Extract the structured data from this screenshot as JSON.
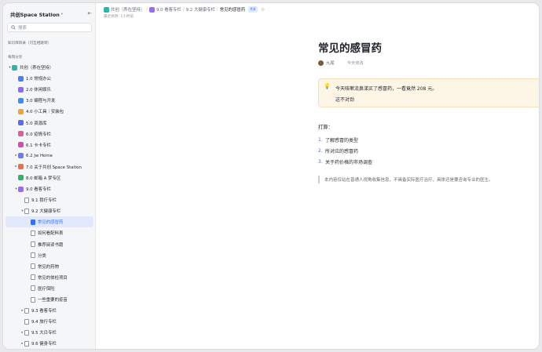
{
  "sidebar": {
    "title": "共创Space Station",
    "search_placeholder": "搜索",
    "section_recent": "知识库目录（可互相跳转）",
    "section_share": "每周分享",
    "tree": [
      {
        "level": 0,
        "arrow": "▾",
        "icon": "node",
        "color": "#2bb5a6",
        "label": "共创（养在坚持）"
      },
      {
        "level": 1,
        "arrow": "",
        "icon": "node",
        "color": "#4a7cff",
        "label": "1.0 常规办公"
      },
      {
        "level": 1,
        "arrow": "",
        "icon": "node",
        "color": "#8b6bf5",
        "label": "2.0 休闲娱乐"
      },
      {
        "level": 1,
        "arrow": "",
        "icon": "node",
        "color": "#3a8cff",
        "label": "3.0 编程与开发"
      },
      {
        "level": 1,
        "arrow": "",
        "icon": "node",
        "color": "#f0a23a",
        "label": "4.0 小工具｜安装包"
      },
      {
        "level": 1,
        "arrow": "",
        "icon": "node",
        "color": "#5b6cf0",
        "label": "5.0 资源库"
      },
      {
        "level": 1,
        "arrow": "",
        "icon": "node",
        "color": "#e05aa0",
        "label": "6.0 疫情专栏"
      },
      {
        "level": 1,
        "arrow": "",
        "icon": "node",
        "color": "#d848b8",
        "label": "6.1 卡卡专栏"
      },
      {
        "level": 1,
        "arrow": "▸",
        "icon": "node",
        "color": "#6a7cf2",
        "label": "6.2 Jw Home"
      },
      {
        "level": 1,
        "arrow": "▸",
        "icon": "node",
        "color": "#f26c4f",
        "label": "7.0 关于共创 Space Station"
      },
      {
        "level": 1,
        "arrow": "",
        "icon": "node",
        "color": "#2bb56a",
        "label": "8.0 邮箱 A 梦专区"
      },
      {
        "level": 1,
        "arrow": "▾",
        "icon": "node",
        "color": "#9c6bf5",
        "label": "9.0 看客专栏"
      },
      {
        "level": 2,
        "arrow": "",
        "icon": "doc",
        "color": "",
        "label": "9.1 猜疗专栏"
      },
      {
        "level": 2,
        "arrow": "▾",
        "icon": "doc",
        "color": "",
        "label": "9.2 大健康专栏"
      },
      {
        "level": 3,
        "arrow": "",
        "icon": "doc",
        "color": "",
        "label": "常见的感冒药",
        "active": true
      },
      {
        "level": 3,
        "arrow": "",
        "icon": "doc",
        "color": "",
        "label": "如何看配料表"
      },
      {
        "level": 3,
        "arrow": "",
        "icon": "doc",
        "color": "",
        "label": "推荐阅读书籍"
      },
      {
        "level": 3,
        "arrow": "",
        "icon": "doc",
        "color": "",
        "label": "分类"
      },
      {
        "level": 3,
        "arrow": "",
        "icon": "doc",
        "color": "",
        "label": "常见的药物"
      },
      {
        "level": 3,
        "arrow": "",
        "icon": "doc",
        "color": "",
        "label": "常见的体检项目"
      },
      {
        "level": 3,
        "arrow": "",
        "icon": "doc",
        "color": "",
        "label": "医疗保险"
      },
      {
        "level": 3,
        "arrow": "",
        "icon": "doc",
        "color": "",
        "label": "一些重要的疫苗"
      },
      {
        "level": 2,
        "arrow": "▸",
        "icon": "doc",
        "color": "",
        "label": "9.3 看客专栏"
      },
      {
        "level": 2,
        "arrow": "",
        "icon": "doc",
        "color": "",
        "label": "9.4 旅行专栏"
      },
      {
        "level": 2,
        "arrow": "▸",
        "icon": "doc",
        "color": "",
        "label": "9.5 大日专栏"
      },
      {
        "level": 2,
        "arrow": "▸",
        "icon": "doc",
        "color": "",
        "label": "9.6 健身专栏"
      }
    ]
  },
  "topbar": {
    "crumbs": [
      {
        "label": "共创（养在坚持）",
        "color": "#2bb5a6"
      },
      {
        "label": "9.0 看客专栏",
        "color": "#9c6bf5"
      },
      {
        "label": "9.2 大健康专栏",
        "color": ""
      },
      {
        "label": "常见的感冒药",
        "color": ""
      }
    ],
    "tag": "共享",
    "edited": "最近修改: 1小时前"
  },
  "doc": {
    "title": "常见的感冒药",
    "author": "九尾",
    "time": "今天修改",
    "callout_line1": "今天咳嗽流鼻涕买了感冒药，一看竟然 208 元。",
    "callout_line2": "这不对劲",
    "plan_label": "打算：",
    "plan": [
      "了解感冒的类型",
      "所对应的感冒药",
      "关于药价格的市场调查"
    ],
    "disclaimer": "本内容仅站在普通人视角收集信息，不具备实际医疗治疗，具体还是要咨询专业的医生。"
  }
}
